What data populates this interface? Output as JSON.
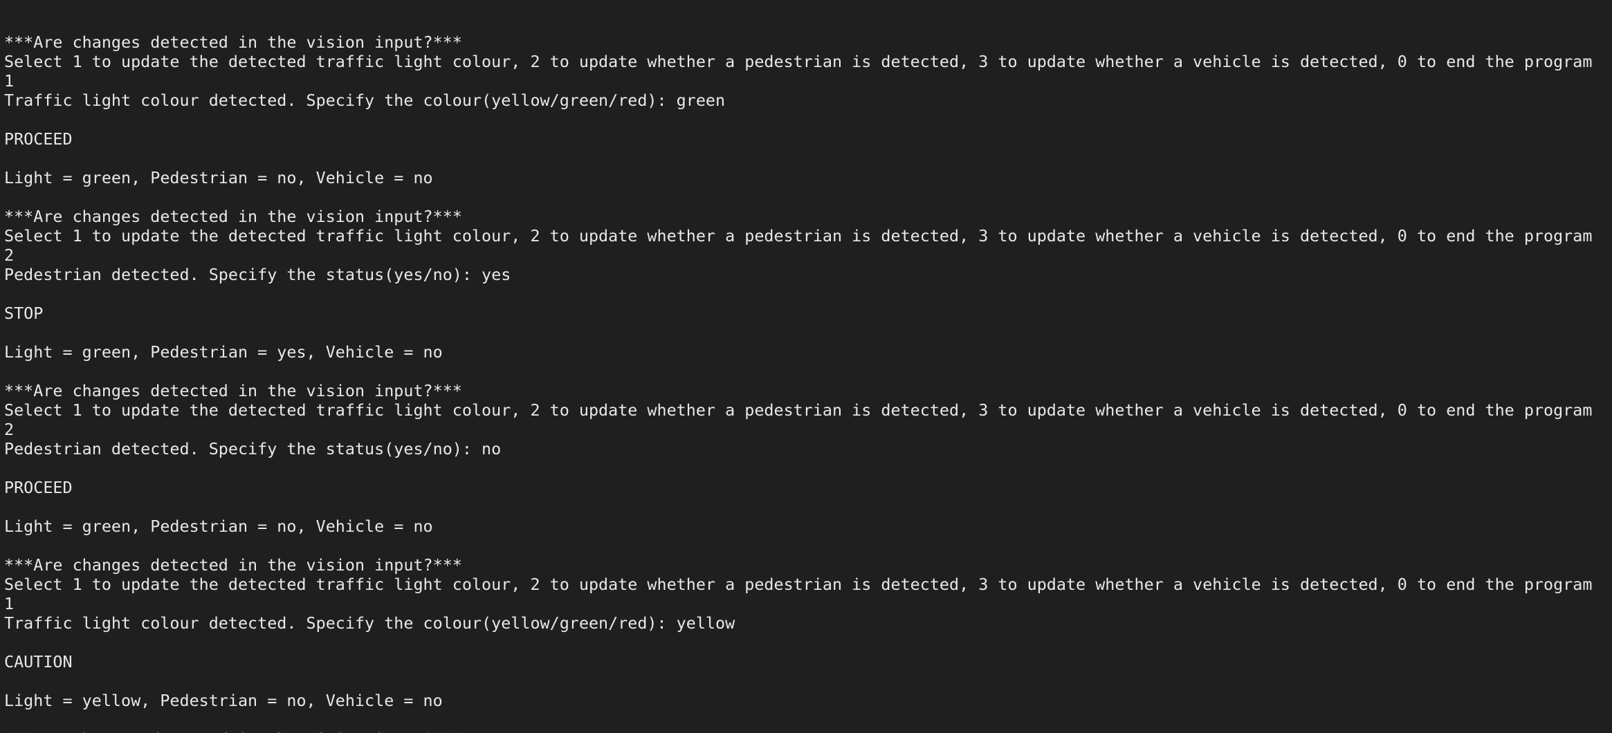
{
  "terminal": {
    "lines": [
      "***Are changes detected in the vision input?***",
      "Select 1 to update the detected traffic light colour, 2 to update whether a pedestrian is detected, 3 to update whether a vehicle is detected, 0 to end the program",
      "1",
      "Traffic light colour detected. Specify the colour(yellow/green/red): green",
      "",
      "PROCEED",
      "",
      "Light = green, Pedestrian = no, Vehicle = no",
      "",
      "***Are changes detected in the vision input?***",
      "Select 1 to update the detected traffic light colour, 2 to update whether a pedestrian is detected, 3 to update whether a vehicle is detected, 0 to end the program",
      "2",
      "Pedestrian detected. Specify the status(yes/no): yes",
      "",
      "STOP",
      "",
      "Light = green, Pedestrian = yes, Vehicle = no",
      "",
      "***Are changes detected in the vision input?***",
      "Select 1 to update the detected traffic light colour, 2 to update whether a pedestrian is detected, 3 to update whether a vehicle is detected, 0 to end the program",
      "2",
      "Pedestrian detected. Specify the status(yes/no): no",
      "",
      "PROCEED",
      "",
      "Light = green, Pedestrian = no, Vehicle = no",
      "",
      "***Are changes detected in the vision input?***",
      "Select 1 to update the detected traffic light colour, 2 to update whether a pedestrian is detected, 3 to update whether a vehicle is detected, 0 to end the program",
      "1",
      "Traffic light colour detected. Specify the colour(yellow/green/red): yellow",
      "",
      "CAUTION",
      "",
      "Light = yellow, Pedestrian = no, Vehicle = no",
      "",
      "***Are changes detected in the vision input?***"
    ],
    "colors": {
      "background": "#1f1f1f",
      "text": "#e8e8e8"
    }
  }
}
